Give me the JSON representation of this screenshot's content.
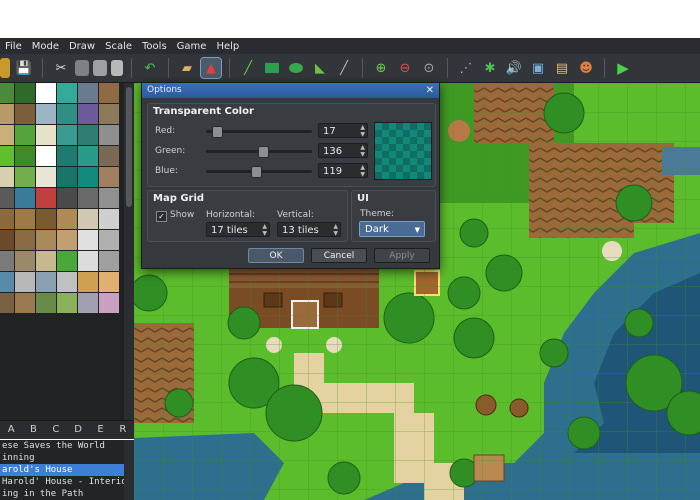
{
  "menu": [
    "File",
    "Mode",
    "Draw",
    "Scale",
    "Tools",
    "Game",
    "Help"
  ],
  "toolbar_icons": [
    "open-icon",
    "cut-icon",
    "copy-icon",
    "paste-icon",
    "delete-icon",
    "undo-icon",
    "layer-lower-icon",
    "layer-event-icon",
    "pencil-icon",
    "rectangle-icon",
    "ellipse-icon",
    "fill-icon",
    "shadow-pen-icon",
    "zoom-in-icon",
    "zoom-out-icon",
    "zoom-reset-icon",
    "tileset-icon",
    "plugin-icon",
    "sound-icon",
    "resource-icon",
    "character-icon",
    "playtest-icon"
  ],
  "tile_colors": [
    "#4c8a3b",
    "#2f6a2a",
    "#ffffff",
    "#36a89a",
    "#6a7b90",
    "#8e6a45",
    "#b79a6a",
    "#7b5f3a",
    "#9bb5c5",
    "#2f8f84",
    "#6c5a9a",
    "#8a7a5a",
    "#c9b07a",
    "#54a43c",
    "#e8e2c9",
    "#3b9b8e",
    "#2d7d73",
    "#8f8f8f",
    "#5fbf2f",
    "#3f8a2a",
    "#ffffff",
    "#1f7a70",
    "#2a9a8a",
    "#7a6a55",
    "#d8d0b0",
    "#6fae4a",
    "#e9e6d6",
    "#197468",
    "#128a7c",
    "#a08060",
    "#5a5a5a",
    "#3a7a9a",
    "#c04040",
    "#4a4a4a",
    "#6a6a6a",
    "#909090",
    "#8a6a3a",
    "#a07a45",
    "#7a5a30",
    "#b08a55",
    "#d0c8b0",
    "#cfcfcf",
    "#6a4a2a",
    "#8a6a42",
    "#a88a5a",
    "#c0a070",
    "#e0e0e0",
    "#b0b0b0",
    "#7a7a7a",
    "#9a8a6a",
    "#c8b890",
    "#4aa838",
    "#dcdcdc",
    "#a0a0a0",
    "#5a8aaa",
    "#b8b8b8",
    "#8aa0b0",
    "#c0c0c0",
    "#d0a050",
    "#e0b070",
    "#7a6040",
    "#9a7850",
    "#6a8a4a",
    "#8ab05a",
    "#a0a0b0",
    "#c8a0c0"
  ],
  "tileset_tabs": [
    "A",
    "B",
    "C",
    "D",
    "E",
    "R"
  ],
  "map_list": [
    "ese Saves the World",
    "inning",
    "arold's House",
    "Harold' House - Interior",
    "ing in the Path"
  ],
  "map_list_selected": 2,
  "dialog": {
    "title": "Options",
    "close": "✕",
    "transparent_color": {
      "label": "Transparent Color",
      "red_label": "Red:",
      "red": "17",
      "red_frac": 0.067,
      "green_label": "Green:",
      "green": "136",
      "green_frac": 0.533,
      "blue_label": "Blue:",
      "blue": "119",
      "blue_frac": 0.467,
      "swatch_color": "#118877"
    },
    "map_grid": {
      "label": "Map Grid",
      "show_label": "Show",
      "show_checked": true,
      "horizontal_label": "Horizontal:",
      "horizontal": "17 tiles",
      "vertical_label": "Vertical:",
      "vertical": "13 tiles"
    },
    "ui": {
      "label": "UI",
      "theme_label": "Theme:",
      "theme": "Dark"
    },
    "ok": "OK",
    "cancel": "Cancel",
    "apply": "Apply"
  }
}
